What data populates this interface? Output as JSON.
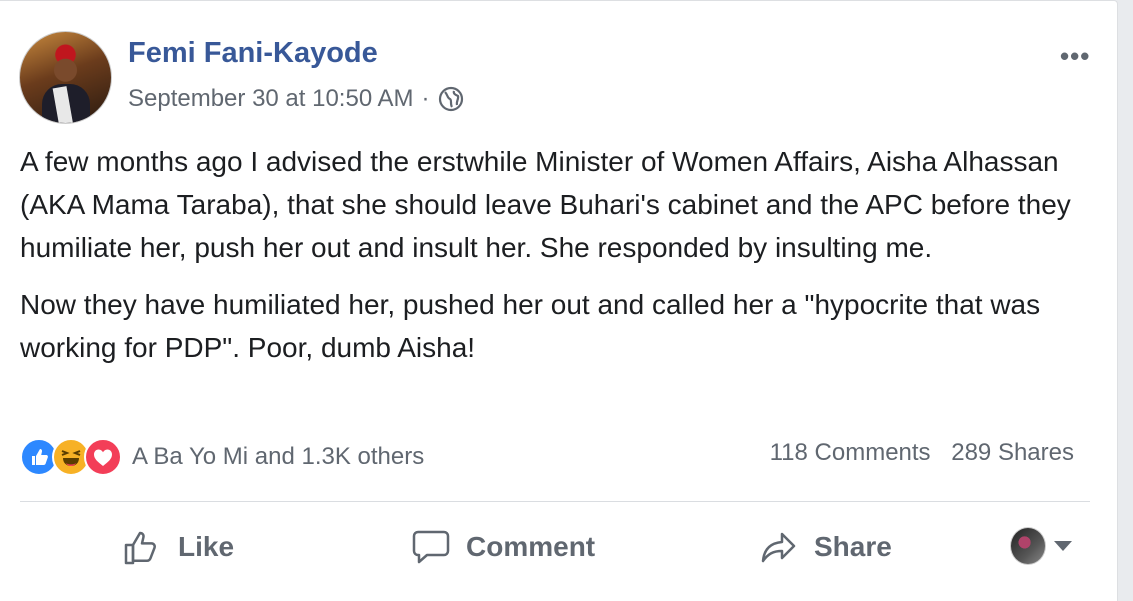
{
  "post": {
    "author": "Femi Fani-Kayode",
    "timestamp": "September 30 at 10:50 AM",
    "separator": "·",
    "privacy_icon": "globe-icon",
    "more_label": "•••",
    "paragraphs": [
      "A few months ago I advised the erstwhile Minister of Women Affairs, Aisha Alhassan (AKA Mama Taraba), that she should leave Buhari's cabinet and the APC before they humiliate her, push her out and insult her. She responded by insulting me.",
      "Now they have humiliated her, pushed her out and called her a \"hypocrite that was working for PDP\". Poor, dumb Aisha!"
    ]
  },
  "reactions": {
    "icons": [
      "like-reaction-icon",
      "haha-reaction-icon",
      "love-reaction-icon"
    ],
    "summary": "A Ba Yo Mi and 1.3K others",
    "comments": "118 Comments",
    "shares": "289 Shares"
  },
  "actions": {
    "like": "Like",
    "comment": "Comment",
    "share": "Share"
  },
  "colors": {
    "name": "#385898",
    "muted": "#606770",
    "text": "#1c1e21",
    "like_blue": "#2d88ff",
    "haha_yellow": "#f7b125",
    "love_red": "#f33e58"
  }
}
